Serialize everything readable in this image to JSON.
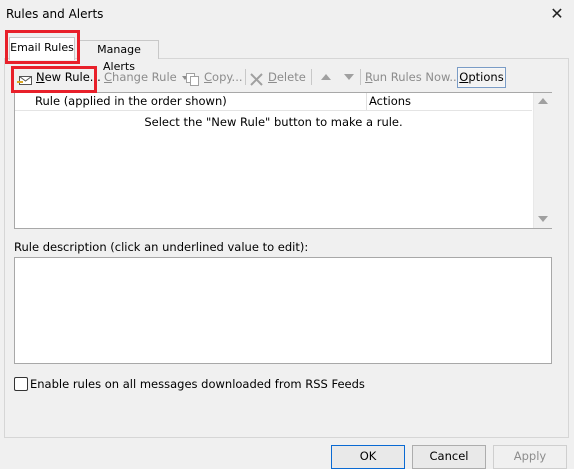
{
  "window": {
    "title": "Rules and Alerts",
    "close_glyph": "✕"
  },
  "tabs": [
    {
      "label": "Email Rules",
      "active": true
    },
    {
      "label": "Manage Alerts",
      "active": false
    }
  ],
  "toolbar": {
    "new_rule": {
      "label_u": "N",
      "label_rest": "ew Rule...",
      "icon": "new-rule-icon",
      "enabled": true
    },
    "change_rule": {
      "label_u": "C",
      "label_rest": "hange Rule",
      "icon": "dropdown-caret-icon",
      "enabled": false
    },
    "copy": {
      "label_u": "C",
      "label_rest": "opy...",
      "icon": "copy-icon",
      "enabled": false
    },
    "delete": {
      "label_u": "D",
      "label_rest": "elete",
      "icon": "delete-x-icon",
      "enabled": false
    },
    "move_up": {
      "icon": "move-up-icon",
      "enabled": false
    },
    "move_down": {
      "icon": "move-down-icon",
      "enabled": false
    },
    "run_rules_now": {
      "label_u": "R",
      "label_rest": "un Rules Now...",
      "enabled": false
    },
    "options": {
      "label_u": "O",
      "label_rest": "ptions",
      "enabled": true
    }
  },
  "rules_list": {
    "columns": [
      "Rule (applied in the order shown)",
      "Actions"
    ],
    "empty_message": "Select the \"New Rule\" button to make a rule."
  },
  "description": {
    "label": "Rule description (click an underlined value to edit):",
    "value": ""
  },
  "rss_option": {
    "label": "Enable rules on all messages downloaded from RSS Feeds",
    "checked": false
  },
  "buttons": {
    "ok": "OK",
    "cancel": "Cancel",
    "apply": "Apply"
  },
  "colors": {
    "highlight": "#e8202a",
    "focus_border": "#0a6ad3",
    "disabled_text": "#8c8c8c"
  }
}
